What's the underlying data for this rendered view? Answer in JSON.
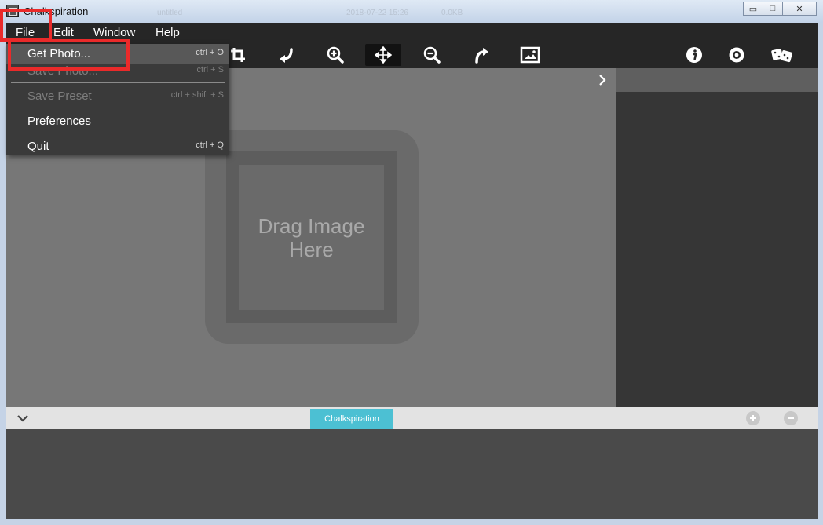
{
  "window": {
    "title": "Chalkspiration",
    "ghost_tab": "untitled",
    "ghost_time": "2018-07-22 15:26",
    "ghost_size": "0.0KB",
    "controls": {
      "minimize": "▭",
      "maximize": "□",
      "close": "✕"
    }
  },
  "menubar": {
    "items": [
      {
        "label": "File"
      },
      {
        "label": "Edit"
      },
      {
        "label": "Window"
      },
      {
        "label": "Help"
      }
    ]
  },
  "file_menu": {
    "items": [
      {
        "label": "Get Photo...",
        "shortcut": "ctrl + O",
        "enabled": true,
        "highlighted": true
      },
      {
        "label": "Save Photo...",
        "shortcut": "ctrl + S",
        "enabled": false
      },
      {
        "label": "Save Preset",
        "shortcut": "ctrl + shift + S",
        "enabled": false
      },
      {
        "label": "Preferences",
        "shortcut": "",
        "enabled": true
      },
      {
        "label": "Quit",
        "shortcut": "ctrl + Q",
        "enabled": true
      }
    ]
  },
  "toolbar": {
    "tools": [
      "crop-icon",
      "rotate-left-icon",
      "zoom-in-icon",
      "move-icon",
      "zoom-out-icon",
      "rotate-right-icon",
      "photo-frame-icon"
    ],
    "active_tool": "move-icon",
    "right_tools": [
      "info-icon",
      "settings-icon",
      "dice-icon"
    ]
  },
  "canvas": {
    "placeholder": "Drag Image Here"
  },
  "bottom_tabs": {
    "active_tab": "Chalkspiration",
    "accent": "#4cc0d3"
  },
  "colors": {
    "highlight": "#ea2a2a"
  }
}
